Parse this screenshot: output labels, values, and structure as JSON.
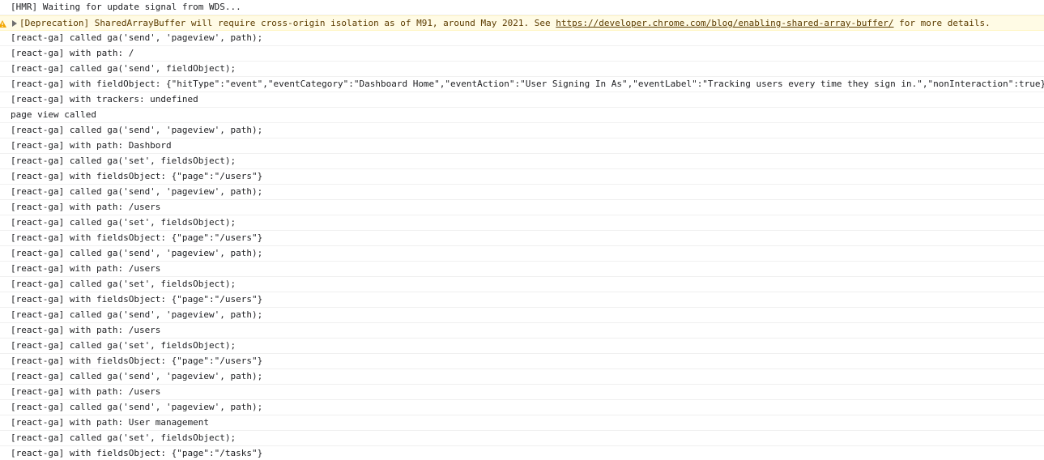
{
  "colors": {
    "warning_background": "#fffbe5",
    "warning_text": "#5c3c00",
    "warning_icon": "#f2a600",
    "row_divider": "#f0f0f0",
    "text": "#202124"
  },
  "console": {
    "hmr_message": "[HMR] Waiting for update signal from WDS...",
    "warning": {
      "icon": "warning-icon",
      "prefix": "[Deprecation] SharedArrayBuffer will require cross-origin isolation as of M91, around May 2021. See ",
      "link_text": "https://developer.chrome.com/blog/enabling-shared-array-buffer/",
      "suffix": " for more details."
    },
    "messages": [
      "[react-ga] called ga('send', 'pageview', path);",
      "[react-ga] with path: /",
      "[react-ga] called ga('send', fieldObject);",
      "[react-ga] with fieldObject: {\"hitType\":\"event\",\"eventCategory\":\"Dashboard Home\",\"eventAction\":\"User Signing In As\",\"eventLabel\":\"Tracking users every time they sign in.\",\"nonInteraction\":true}",
      "[react-ga] with trackers: undefined",
      "page view called",
      "[react-ga] called ga('send', 'pageview', path);",
      "[react-ga] with path: Dashbord",
      "[react-ga] called ga('set', fieldsObject);",
      "[react-ga] with fieldsObject: {\"page\":\"/users\"}",
      "[react-ga] called ga('send', 'pageview', path);",
      "[react-ga] with path: /users",
      "[react-ga] called ga('set', fieldsObject);",
      "[react-ga] with fieldsObject: {\"page\":\"/users\"}",
      "[react-ga] called ga('send', 'pageview', path);",
      "[react-ga] with path: /users",
      "[react-ga] called ga('set', fieldsObject);",
      "[react-ga] with fieldsObject: {\"page\":\"/users\"}",
      "[react-ga] called ga('send', 'pageview', path);",
      "[react-ga] with path: /users",
      "[react-ga] called ga('set', fieldsObject);",
      "[react-ga] with fieldsObject: {\"page\":\"/users\"}",
      "[react-ga] called ga('send', 'pageview', path);",
      "[react-ga] with path: /users",
      "[react-ga] called ga('send', 'pageview', path);",
      "[react-ga] with path: User management",
      "[react-ga] called ga('set', fieldsObject);",
      "[react-ga] with fieldsObject: {\"page\":\"/tasks\"}"
    ]
  }
}
